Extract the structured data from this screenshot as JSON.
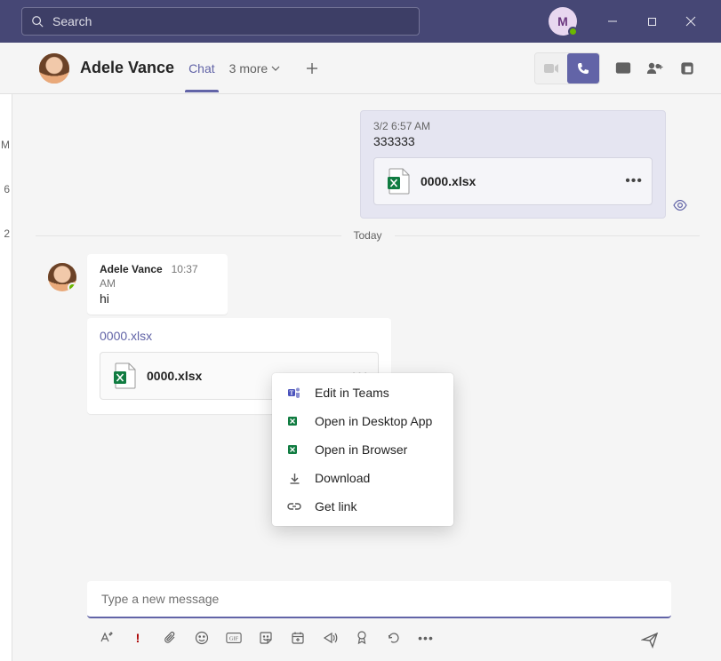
{
  "titlebar": {
    "search_placeholder": "Search",
    "profile_initial": "M"
  },
  "header": {
    "person_name": "Adele Vance",
    "tab_label": "Chat",
    "more_tabs": "3 more"
  },
  "sidestrip": {
    "a": "M",
    "b": "6",
    "c": "2"
  },
  "sent": {
    "meta": "3/2 6:57 AM",
    "text": "333333",
    "filename": "0000.xlsx"
  },
  "divider": "Today",
  "recv": {
    "sender": "Adele Vance",
    "time": "10:37 AM",
    "body": "hi",
    "linktext": "0000.xlsx",
    "filename": "0000.xlsx"
  },
  "ctx": {
    "edit_in_teams": "Edit in Teams",
    "open_desktop": "Open in Desktop App",
    "open_browser": "Open in Browser",
    "download": "Download",
    "get_link": "Get link"
  },
  "compose": {
    "placeholder": "Type a new message"
  }
}
